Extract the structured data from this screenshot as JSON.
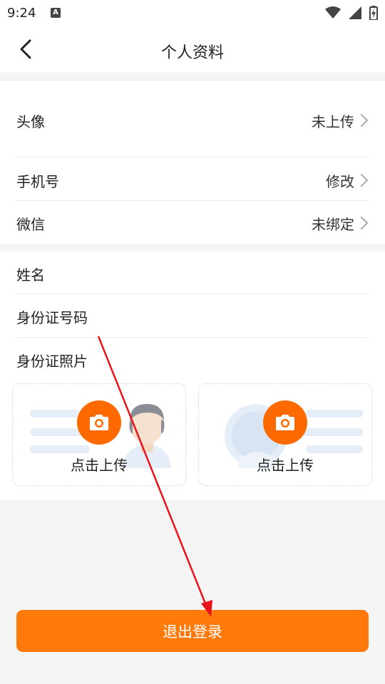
{
  "status_bar": {
    "time": "9:24",
    "notification_letter": "A"
  },
  "header": {
    "title": "个人资料"
  },
  "profile": {
    "avatar": {
      "label": "头像",
      "value": "未上传"
    },
    "phone": {
      "label": "手机号",
      "value": "修改"
    },
    "wechat": {
      "label": "微信",
      "value": "未绑定"
    }
  },
  "identity": {
    "name_label": "姓名",
    "id_number_label": "身份证号码",
    "id_photo_label": "身份证照片",
    "front_card": {
      "upload_text": "点击上传"
    },
    "back_card": {
      "upload_text": "点击上传"
    }
  },
  "logout": {
    "label": "退出登录"
  },
  "colors": {
    "accent": "#ff7a0a",
    "camera_button": "#ff6a00",
    "annotation_arrow": "#e8141c"
  },
  "icons": [
    "back-arrow-icon",
    "chevron-right-icon",
    "camera-icon",
    "wifi-icon",
    "signal-icon",
    "battery-icon"
  ]
}
